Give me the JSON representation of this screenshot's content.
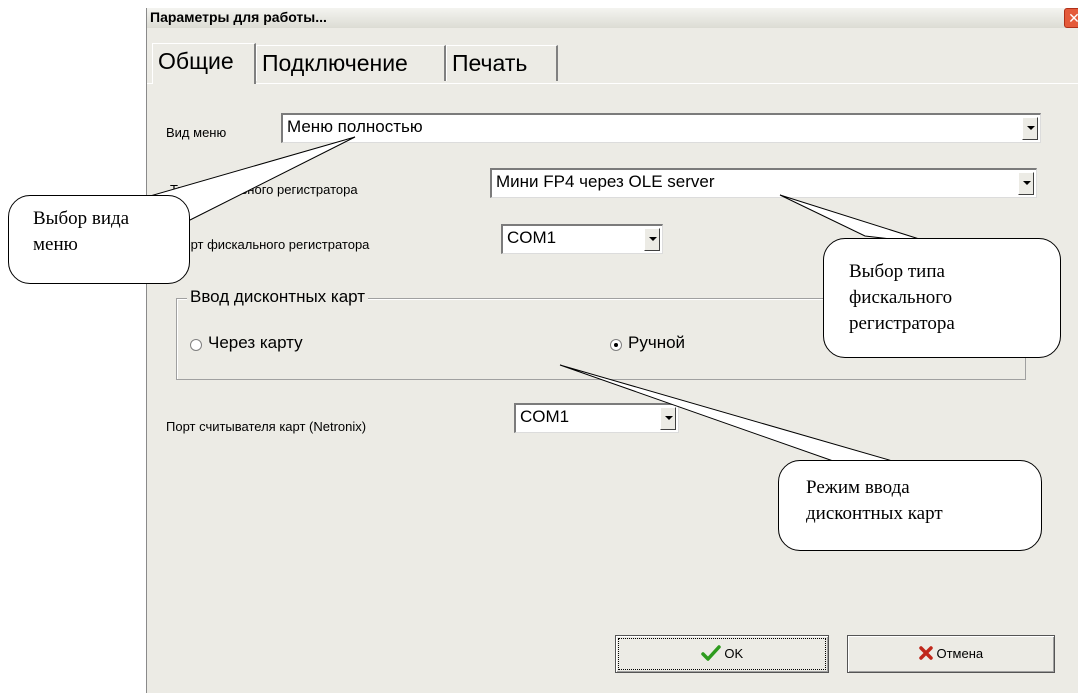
{
  "window": {
    "title": "Параметры для работы...",
    "close_glyph": "✕"
  },
  "tabs": [
    {
      "label": "Общие",
      "active": true
    },
    {
      "label": "Подключение",
      "active": false
    },
    {
      "label": "Печать",
      "active": false
    }
  ],
  "fields": {
    "menu_type": {
      "label": "Вид меню",
      "value": "Меню полностью"
    },
    "fiscal_type": {
      "label": "Тип фискального регистратора",
      "value": "Мини FP4 через OLE server"
    },
    "fiscal_port": {
      "label": "Порт фискального регистратора",
      "value": "COM1"
    },
    "card_reader_port": {
      "label": "Порт считывателя карт (Netronix)",
      "value": "COM1"
    }
  },
  "discount_group": {
    "title": "Ввод дисконтных карт",
    "options": [
      {
        "label": "Через карту",
        "selected": false
      },
      {
        "label": "Ручной",
        "selected": true
      }
    ]
  },
  "buttons": {
    "ok": {
      "label": "OK",
      "icon": "check-icon"
    },
    "cancel": {
      "label": "Отмена",
      "icon": "cross-icon"
    }
  },
  "callouts": {
    "menu": {
      "line1": "Выбор вида",
      "line2": "меню"
    },
    "fiscal": {
      "line1": "Выбор типа",
      "line2": "фискального",
      "line3": "регистратора"
    },
    "discount": {
      "line1": "Режим ввода",
      "line2": "дисконтных карт"
    }
  },
  "colors": {
    "dialog_bg": "#ecebe5",
    "close_red": "#e45a3a",
    "check_green": "#2e9b1e",
    "cross_red": "#c0281c"
  }
}
